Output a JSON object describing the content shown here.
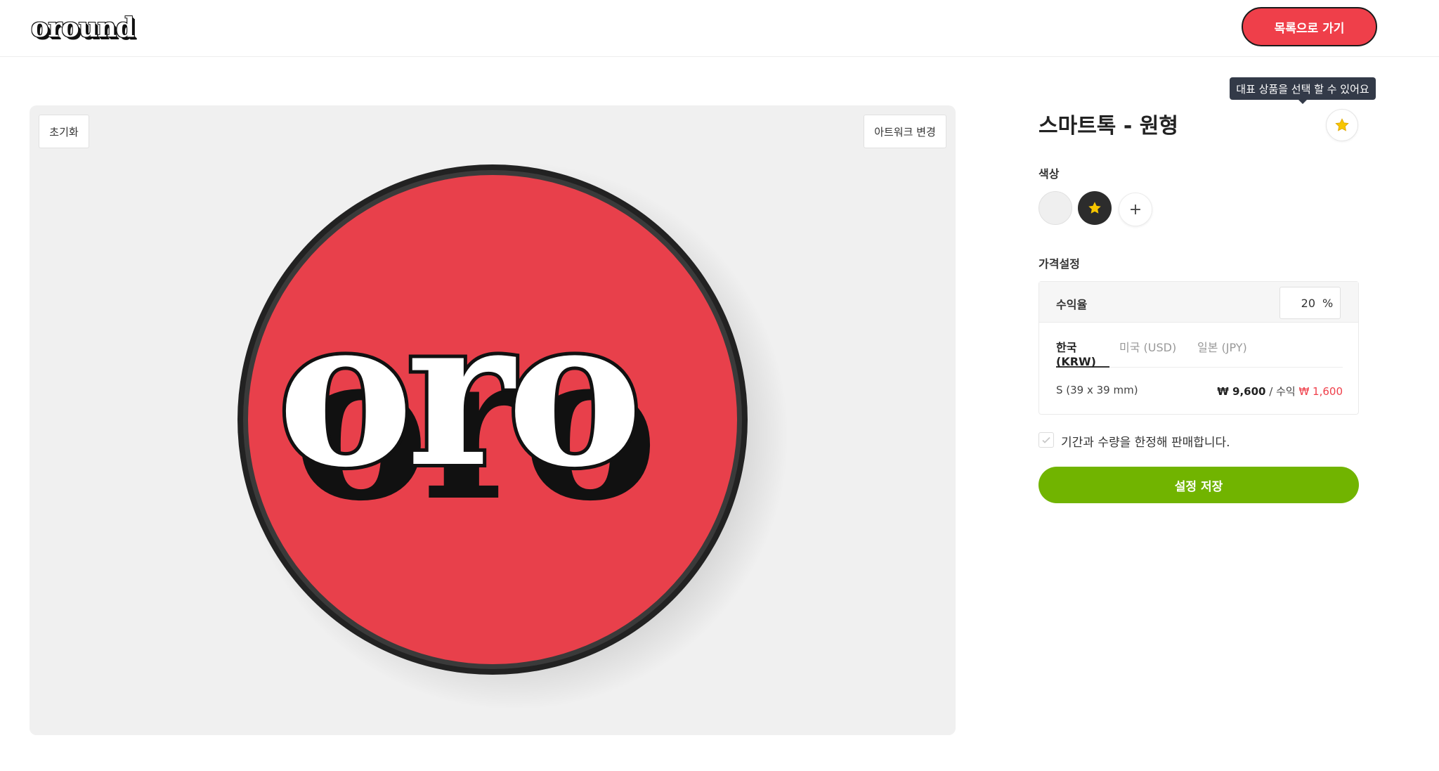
{
  "header": {
    "logo": "oround",
    "back_button": "목록으로 가기"
  },
  "canvas": {
    "reset_label": "초기화",
    "change_artwork_label": "아트워크 변경",
    "artwork_text": "oro",
    "artwork_color": "#e8404b"
  },
  "product": {
    "tooltip": "대표 상품을 선택 할 수 있어요",
    "title": "스마트톡 - 원형",
    "favorite_icon": "star-icon",
    "color_label": "색상",
    "colors": [
      "#efefef",
      "#2c2c2c"
    ],
    "add_color_label": "+",
    "price_label": "가격설정",
    "margin_label": "수익율",
    "margin_value": "20",
    "margin_unit": "%",
    "tabs": [
      {
        "label": "한국 (KRW)",
        "active": true
      },
      {
        "label": "미국 (USD)",
        "active": false
      },
      {
        "label": "일본 (JPY)",
        "active": false
      }
    ],
    "size": "S (39 x 39 mm)",
    "price": "₩ 9,600",
    "separator": " / 수익 ",
    "profit": "₩ 1,600",
    "limit_label": "기간과 수량을 한정해 판매합니다.",
    "save_button": "설정 저장"
  },
  "colors": {
    "accent_red": "#ef3f4a",
    "save_green": "#71b400",
    "star_yellow": "#f7c600"
  }
}
